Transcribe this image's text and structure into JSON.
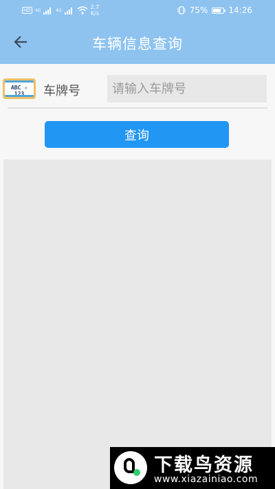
{
  "status_bar": {
    "net_speed_value": "2.7",
    "net_speed_unit": "K/s",
    "network_labels": [
      "HD",
      "HD",
      "4G",
      "4G"
    ],
    "battery_percent": "75%",
    "time": "14:26"
  },
  "header": {
    "title": "车辆信息查询",
    "back_icon": "arrow-left-icon",
    "background_color": "#8ec3f0"
  },
  "form": {
    "plate_icon": "license-plate-icon",
    "plate_icon_text": "ABC - 123",
    "plate_label": "车牌号",
    "plate_input_value": "",
    "plate_input_placeholder": "请输入车牌号"
  },
  "actions": {
    "query_label": "查询",
    "query_color": "#2196f3"
  },
  "watermark": {
    "title": "下载鸟资源",
    "url": "www.xiazainiao.com"
  }
}
